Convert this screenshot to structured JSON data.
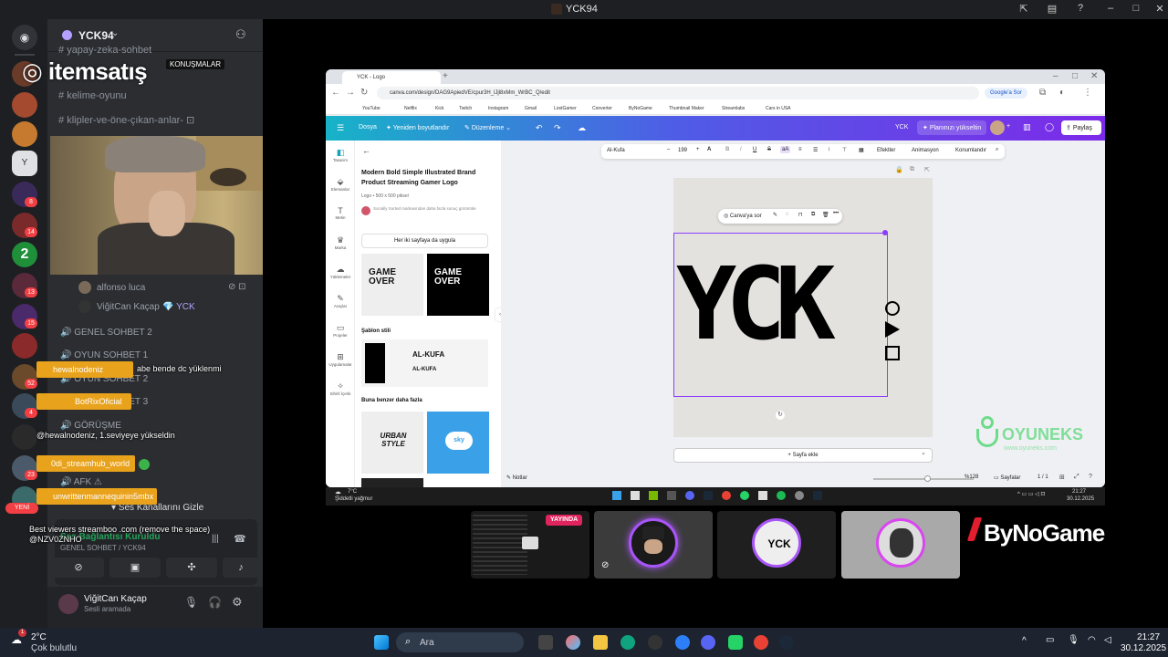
{
  "window": {
    "title": "YCK94"
  },
  "discord": {
    "server_name": "YCK94",
    "text_channels": [
      "yapay-zeka-sohbet",
      "kelime-oyunu",
      "klipler-ve-öne-çıkan-anlar-"
    ],
    "watermark": "itemsatış",
    "banner_text": "KONUŞMALAR",
    "voice_users": [
      "alfonso luca",
      "ViğitCan Kaçap",
      "YCK"
    ],
    "voice_channels": [
      "GENEL SOHBET 2",
      "OYUN SOHBET 1",
      "OYUN SOHBET 2",
      "OYUN SOHBET 3",
      "GÖRÜŞME",
      "AFK"
    ],
    "server_badges": [
      "8",
      "14",
      "13",
      "15",
      "52",
      "4",
      "23"
    ],
    "new_label": "YENİ",
    "hide_voice": "Ses Kanallarını Gizle",
    "voice_connected": "Ses Bağlantısı Kuruldu",
    "voice_location": "GENEL SOHBET / YCK94",
    "user_name": "ViğitCan Kaçap",
    "user_status": "Sesli aramada"
  },
  "chat": [
    {
      "user": "hewalnodeniz",
      "text": "abe bende dc yüklenmi"
    },
    {
      "user": "BotRixOficial",
      "text": "@hewalnodeniz, 1.seviyeye yükseldin"
    },
    {
      "user": "0di_streamhub_world",
      "text": ""
    },
    {
      "user": "unwrittenmannequinin5mbx",
      "text": "Best viewers streamboo .com (remove the space) @NZV0ZNHO"
    }
  ],
  "browser": {
    "tab_title": "YCK - Logo",
    "url": "canva.com/design/DAG9ApiedVE/cpur3H_lJjl8xMm_WrBC_Q/edit",
    "google_btn": "Google'a Sor",
    "bookmarks": [
      "YouTube",
      "Netflix",
      "Kick",
      "Twitch",
      "Instagram",
      "Gmail",
      "LostGamer",
      "Converter",
      "ByNoGame",
      "Thumbnail Maker",
      "Streamlabs",
      "Cars in USA"
    ]
  },
  "canva": {
    "menu": [
      "Dosya",
      "Yeniden boyutlandır",
      "Düzenleme"
    ],
    "doc_name": "YCK",
    "upgrade": "Planınızı yükseltin",
    "share": "Paylaş",
    "sidebar": [
      "Tasarım",
      "Elemanlar",
      "Metin",
      "Marka",
      "Yüklemeler",
      "Araçlar",
      "Projeler",
      "Uygulamalar",
      "Sihirli İçerik"
    ],
    "template_title": "Modern Bold Simple Illustrated Brand Product Streaming Gamer Logo",
    "template_meta": "Logo • 500 x 500 piksel",
    "template_author": "Socially Sorted markasından daha fazla sonuç görüntüle",
    "apply_all": "Her iki sayfaya da uygula",
    "style_header": "Şablon stili",
    "similar_header": "Buna benzer daha fazla",
    "font": "Al-Kufa",
    "font_size": "199",
    "toolbar": [
      "Efektler",
      "Animasyon",
      "Konumlandır"
    ],
    "ask_canva": "Canva'ya sor",
    "logo_text": "YCK",
    "add_page": "+ Sayfa ekle",
    "notes": "Notlar",
    "zoom": "%128",
    "pages_label": "Sayfalar",
    "page_count": "1 / 1",
    "game_over": "GAME OVER",
    "al_kufa": "AL-KUFA",
    "urban": "URBAN STYLE",
    "sky": "sky"
  },
  "inner_taskbar": {
    "weather": "7°C",
    "weather_desc": "Şiddetli yağmur",
    "time": "21:27",
    "date": "30.12.2025"
  },
  "overlay": {
    "live": "YAYINDA",
    "brand": "ByNoGame",
    "oyuneks": "OYUNEKS",
    "oyuneks_sub": "www.oyuneks.com",
    "thumb_logo": "YCK"
  },
  "taskbar": {
    "weather": "2°C",
    "weather_desc": "Çok bulutlu",
    "search": "Ara",
    "time": "21:27",
    "date": "30.12.2025",
    "notif": "1"
  },
  "colors": {
    "discord_bg": "#2b2d31",
    "canva_purple": "#7d2ae8",
    "orange": "#e8a21c",
    "live_red": "#e0245e"
  }
}
